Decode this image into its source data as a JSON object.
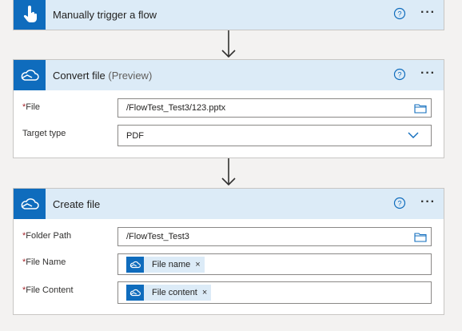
{
  "trigger": {
    "title": "Manually trigger a flow"
  },
  "convert_step": {
    "title": "Convert file",
    "title_suffix": "(Preview)",
    "fields": {
      "file_label": "File",
      "file_value": "/FlowTest_Test3/123.pptx",
      "target_type_label": "Target type",
      "target_type_value": "PDF"
    }
  },
  "create_step": {
    "title": "Create file",
    "fields": {
      "folder_path_label": "Folder Path",
      "folder_path_value": "/FlowTest_Test3",
      "file_name_label": "File Name",
      "file_name_token": "File name",
      "file_content_label": "File Content",
      "file_content_token": "File content"
    }
  },
  "symbols": {
    "required": "*",
    "more": "···",
    "remove": "×"
  },
  "icons": {
    "trigger": "hand-tap-icon",
    "connector": "onedrive-cloud-icon",
    "help": "help-circle-icon",
    "more": "more-horizontal-icon",
    "folder": "folder-icon",
    "chevron": "chevron-down-icon",
    "arrow": "arrow-down-icon"
  },
  "colors": {
    "accent": "#0f6cbd",
    "header_bg": "#dcebf7",
    "required": "#a4262c",
    "canvas": "#f3f2f1"
  }
}
